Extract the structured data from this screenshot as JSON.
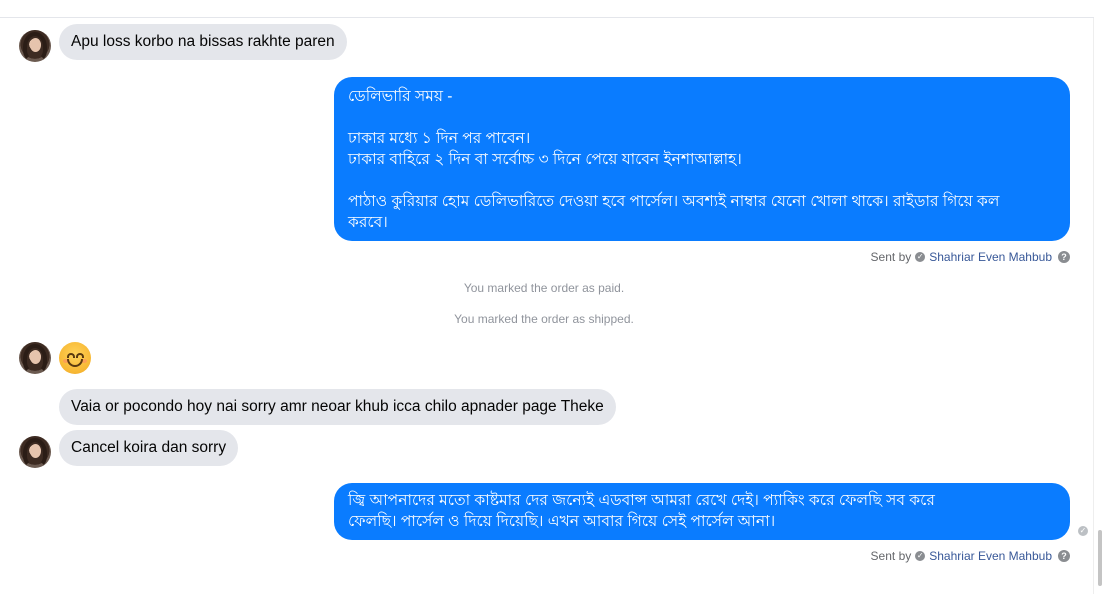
{
  "messages": {
    "m1": "Apu loss korbo na bissas rakhte paren",
    "m2_lines": [
      "ডেলিভারি সময় -",
      "",
      "ঢাকার মধ্যে ১ দিন পর পাবেন।",
      "ঢাকার বাহিরে ২ দিন বা সর্বোচ্চ ৩ দিনে পেয়ে যাবেন ইনশাআল্লাহ।",
      "",
      "পাঠাও কুরিয়ার হোম ডেলিভারিতে দেওয়া হবে পার্সেল। অবশ্যই নাম্বার যেনো খোলা থাকে। রাইডার গিয়ে কল",
      "করবে।"
    ],
    "status_paid": "You marked the order as paid.",
    "status_shipped": "You marked the order as shipped.",
    "m4": "Vaia or pocondo hoy nai sorry amr neoar khub icca chilo apnader page Theke",
    "m5": "Cancel koira dan sorry",
    "m6_lines": [
      "জ্বি আপনাদের মতো কাষ্টমার দের জন্যেই এডবান্স আমরা রেখে দেই। প্যাকিং করে ফেলছি সব করে",
      "ফেলছি। পার্সেল ও দিয়ে দিয়েছি। এখন আবার গিয়ে সেই পার্সেল আনা।"
    ]
  },
  "sent_by": {
    "prefix": "Sent by",
    "name": "Shahriar Even Mahbub",
    "help": "?"
  },
  "icons": {
    "avatar": "contact-avatar",
    "emoji": "smiling-face-emoji",
    "verified": "check-circle-icon",
    "help": "help-circle-icon",
    "seen": "seen-check-icon"
  },
  "colors": {
    "outgoing_bubble": "#0a7cff",
    "incoming_bubble": "#e4e6eb",
    "status_text": "#90949c"
  }
}
